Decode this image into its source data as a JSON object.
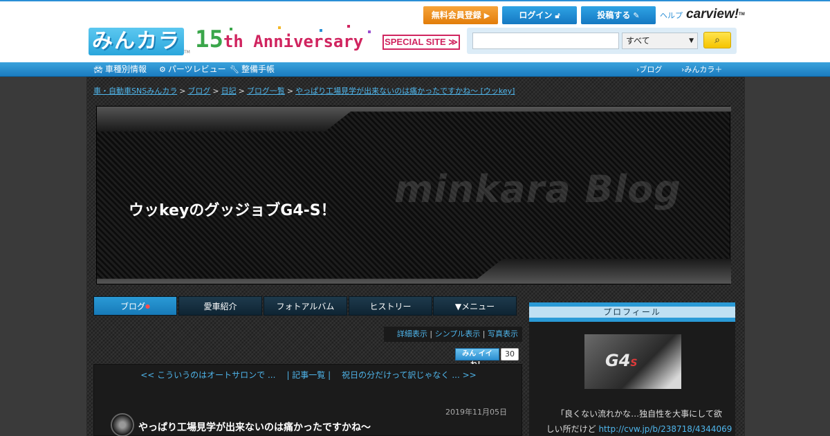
{
  "header": {
    "logo_text": "みんカラ",
    "logo_tm": "TM",
    "anniversary_num": "15",
    "anniversary_suffix": "th Anniversary",
    "special_site": "SPECIAL SITE ≫",
    "register_label": "無料会員登録",
    "login_label": "ログイン",
    "post_label": "投稿する",
    "help_label": "ヘルプ",
    "carview_label": "carview!",
    "carview_tm": "TM",
    "search_value": "",
    "search_select_value": "すべて",
    "search_icon": "magnifier-icon"
  },
  "nav": {
    "left_items": [
      {
        "label": "車種別情報",
        "icon": "car-icon"
      },
      {
        "label": "パーツレビュー",
        "icon": "gear-icon"
      },
      {
        "label": "整備手帳",
        "icon": "wrench-icon"
      }
    ],
    "right_items": [
      {
        "label": "›ブログ"
      },
      {
        "label": "›みんカラ＋"
      }
    ]
  },
  "breadcrumb": [
    "車・自動車SNSみんカラ",
    "ブログ",
    "日記",
    "ブログ一覧",
    "やっぱり工場見学が出来ないのは痛かったですかね～ [ウッkey]"
  ],
  "banner": {
    "watermark": "minkara Blog",
    "title": "ウッkeyのグッジョブG4-S！"
  },
  "tabs": [
    {
      "label": "ブログ",
      "active": true
    },
    {
      "label": "愛車紹介",
      "active": false
    },
    {
      "label": "フォトアルバム",
      "active": false
    },
    {
      "label": "ヒストリー",
      "active": false
    },
    {
      "label": "▼メニュー",
      "active": false
    }
  ],
  "view_modes": [
    "詳細表示",
    "シンプル表示",
    "写真表示"
  ],
  "like": {
    "label": "みん イイね！",
    "count": "30"
  },
  "post": {
    "prev": "<< こういうのはオートサロンで ...",
    "list": "| 記事一覧 |",
    "next": "祝日の分だけって訳じゃなく ... >>",
    "date": "2019年11月05日",
    "title": "やっぱり工場見学が出来ないのは痛かったですかね～"
  },
  "profile": {
    "header": "プロフィール",
    "image_text": "G4",
    "image_s": "S",
    "desc_line1": "「良くない流れかな…独自性を大事にして欲",
    "desc_line2": "しい所だけど",
    "desc_link": "http://cvw.jp/b/238718/4344069"
  },
  "colors": {
    "accent_blue": "#2a8fd6",
    "register_orange": "#f7a43a",
    "link_blue": "#4fb6ec",
    "anniversary_pink": "#d0245f"
  }
}
